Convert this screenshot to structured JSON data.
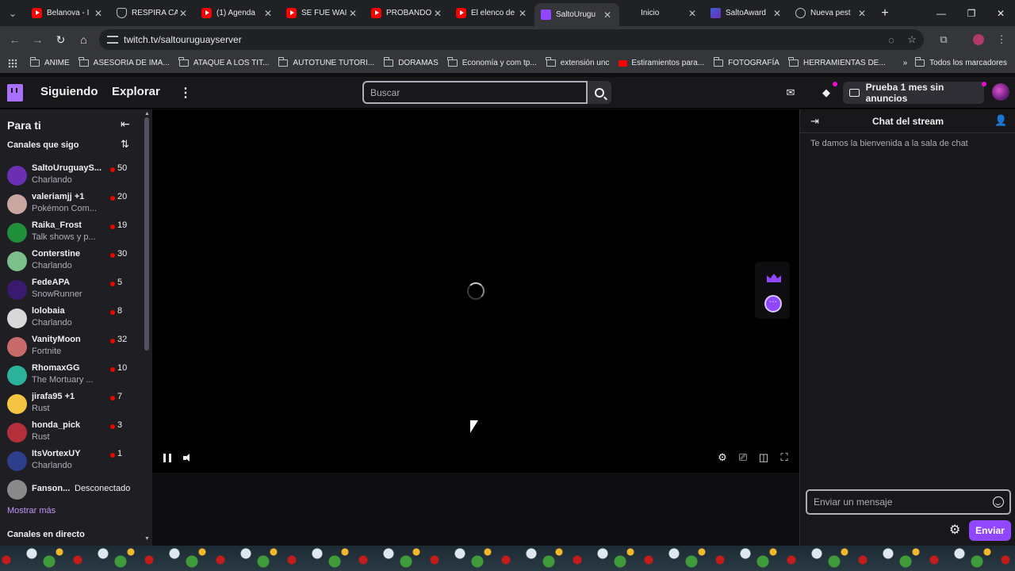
{
  "browser": {
    "tabs": [
      {
        "title": "Belanova - I",
        "favicon": "youtube-icon",
        "active": false
      },
      {
        "title": "RESPIRA CA",
        "favicon": "shield-icon",
        "active": false
      },
      {
        "title": "(1) Agenda",
        "favicon": "youtube-icon",
        "active": false
      },
      {
        "title": "SE FUE WAI",
        "favicon": "youtube-icon",
        "active": false
      },
      {
        "title": "PROBANDO",
        "favicon": "youtube-icon",
        "active": false
      },
      {
        "title": "El elenco de",
        "favicon": "youtube-icon",
        "active": false
      },
      {
        "title": "SaltoUrugu",
        "favicon": "twitch-icon",
        "active": true
      },
      {
        "title": "Inicio",
        "favicon": "",
        "active": false
      },
      {
        "title": "SaltoAward",
        "favicon": "saltoawards-icon",
        "active": false
      },
      {
        "title": "Nueva pest",
        "favicon": "chrome-icon",
        "active": false
      }
    ],
    "url": "twitch.tv/saltouruguayserver",
    "bookmarks": [
      {
        "label": "ANIME",
        "type": "folder"
      },
      {
        "label": "ASESORIA DE IMA...",
        "type": "folder"
      },
      {
        "label": "ATAQUE A LOS TIT...",
        "type": "folder"
      },
      {
        "label": "AUTOTUNE TUTORI...",
        "type": "folder"
      },
      {
        "label": "DORAMAS",
        "type": "folder"
      },
      {
        "label": "Economía y com tp...",
        "type": "folder"
      },
      {
        "label": "extensión unc",
        "type": "folder"
      },
      {
        "label": "Estiramientos para...",
        "type": "youtube"
      },
      {
        "label": "FOTOGRAFÍA",
        "type": "folder"
      },
      {
        "label": "HERRAMIENTAS DE...",
        "type": "folder"
      }
    ],
    "all_bookmarks": "Todos los marcadores"
  },
  "twitch_nav": {
    "following": "Siguiendo",
    "browse": "Explorar",
    "search_placeholder": "Buscar",
    "prime_label": "Prueba 1 mes sin anuncios"
  },
  "sidebar": {
    "title": "Para ti",
    "followed_header": "Canales que sigo",
    "channels": [
      {
        "name": "SaltoUruguayS...",
        "game": "Charlando",
        "viewers": "50",
        "avatar_color": "#6b2fb3"
      },
      {
        "name": "valeriamjj +1",
        "game": "Pokémon Com...",
        "viewers": "20",
        "avatar_color": "#c9a7a0"
      },
      {
        "name": "Raika_Frost",
        "game": "Talk shows y p...",
        "viewers": "19",
        "avatar_color": "#1f8f3a"
      },
      {
        "name": "Conterstine",
        "game": "Charlando",
        "viewers": "30",
        "avatar_color": "#7dbf8a"
      },
      {
        "name": "FedeAPA",
        "game": "SnowRunner",
        "viewers": "5",
        "avatar_color": "#3a1a6e"
      },
      {
        "name": "lolobaia",
        "game": "Charlando",
        "viewers": "8",
        "avatar_color": "#d8d8d8"
      },
      {
        "name": "VanityMoon",
        "game": "Fortnite",
        "viewers": "32",
        "avatar_color": "#c86a6a"
      },
      {
        "name": "RhomaxGG",
        "game": "The Mortuary ...",
        "viewers": "10",
        "avatar_color": "#2ab39a"
      },
      {
        "name": "jirafa95 +1",
        "game": "Rust",
        "viewers": "7",
        "avatar_color": "#f5c542"
      },
      {
        "name": "honda_pick",
        "game": "Rust",
        "viewers": "3",
        "avatar_color": "#b3303a"
      },
      {
        "name": "ItsVortexUY",
        "game": "Charlando",
        "viewers": "1",
        "avatar_color": "#2d3f8a"
      },
      {
        "name": "Fanson...",
        "game": "",
        "viewers": "",
        "offline": "Desconectado",
        "avatar_color": "#8a8a8a"
      }
    ],
    "show_more": "Mostrar más",
    "live_channels_header": "Canales en directo"
  },
  "chat": {
    "title": "Chat del stream",
    "welcome": "Te damos la bienvenida a la sala de chat",
    "input_placeholder": "Enviar un mensaje",
    "send_label": "Enviar"
  },
  "colors": {
    "twitch_purple": "#9146ff",
    "live_red": "#eb0400",
    "link_purple": "#bf94ff"
  }
}
